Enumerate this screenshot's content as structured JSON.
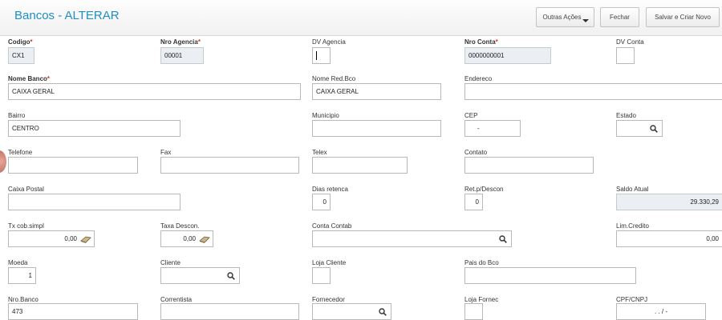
{
  "header": {
    "title": "Bancos - ALTERAR",
    "buttons": {
      "outras_acoes": "Outras Ações",
      "fechar": "Fechar",
      "salvar_criar": "Salvar e Criar Novo"
    }
  },
  "colors": {
    "title": "#1e8fc3",
    "required_marker": "#e0342b",
    "readonly_bg": "#ebeef2"
  },
  "form": {
    "codigo": {
      "label": "Codigo",
      "required": "*",
      "value": "CX1"
    },
    "nro_agencia": {
      "label": "Nro Agencia",
      "required": "*",
      "value": "00001"
    },
    "dv_agencia": {
      "label": "DV Agencia",
      "value": ""
    },
    "nro_conta": {
      "label": "Nro Conta",
      "required": "*",
      "value": "0000000001"
    },
    "dv_conta": {
      "label": "DV Conta",
      "value": ""
    },
    "nome_banco": {
      "label": "Nome Banco",
      "required": "*",
      "value": "CAIXA GERAL"
    },
    "nome_red_bco": {
      "label": "Nome Red.Bco",
      "value": "CAIXA GERAL"
    },
    "endereco": {
      "label": "Endereco",
      "value": ""
    },
    "bairro": {
      "label": "Bairro",
      "value": "CENTRO"
    },
    "municipio": {
      "label": "Municipio",
      "value": ""
    },
    "cep": {
      "label": "CEP",
      "value": "-"
    },
    "estado": {
      "label": "Estado",
      "value": ""
    },
    "telefone": {
      "label": "Telefone",
      "value": ""
    },
    "fax": {
      "label": "Fax",
      "value": ""
    },
    "telex": {
      "label": "Telex",
      "value": ""
    },
    "contato": {
      "label": "Contato",
      "value": ""
    },
    "caixa_postal": {
      "label": "Caixa Postal",
      "value": ""
    },
    "dias_retenca": {
      "label": "Dias retenca",
      "value": "0"
    },
    "ret_p_descon": {
      "label": "Ret.p/Descon",
      "value": "0"
    },
    "saldo_atual": {
      "label": "Saldo Atual",
      "value": "29.330,29"
    },
    "tx_cob_simpl": {
      "label": "Tx cob.simpl",
      "value": "0,00"
    },
    "taxa_descon": {
      "label": "Taxa Descon.",
      "value": "0,00"
    },
    "conta_contab": {
      "label": "Conta Contab",
      "value": ""
    },
    "lim_credito": {
      "label": "Lim.Credito",
      "value": "0,00"
    },
    "moeda": {
      "label": "Moeda",
      "value": "1"
    },
    "cliente": {
      "label": "Cliente",
      "value": ""
    },
    "loja_cliente": {
      "label": "Loja Cliente",
      "value": ""
    },
    "pais_do_bco": {
      "label": "Pais do Bco",
      "value": ""
    },
    "nro_banco": {
      "label": "Nro.Banco",
      "value": "473"
    },
    "correntista": {
      "label": "Correntista",
      "value": ""
    },
    "fornecedor": {
      "label": "Fornecedor",
      "value": ""
    },
    "loja_fornec": {
      "label": "Loja Fornec",
      "value": ""
    },
    "cpf_cnpj": {
      "label": "CPF/CNPJ",
      "value": ". . / -"
    }
  }
}
